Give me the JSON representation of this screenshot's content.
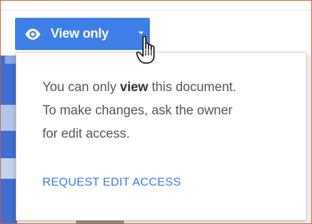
{
  "toolbar": {
    "view_only_label": "View only",
    "icon": "eye-icon",
    "dropdown_icon": "caret-down-icon",
    "accent_color": "#3d7fe6"
  },
  "popup": {
    "line1_prefix": "You can only ",
    "line1_bold": "view",
    "line1_suffix": " this document.",
    "line2": "To make changes, ask the owner",
    "line3": "for edit access.",
    "request_link": "REQUEST EDIT ACCESS",
    "link_color": "#3b78e7"
  },
  "cursor": {
    "icon": "hand-pointer-icon"
  }
}
